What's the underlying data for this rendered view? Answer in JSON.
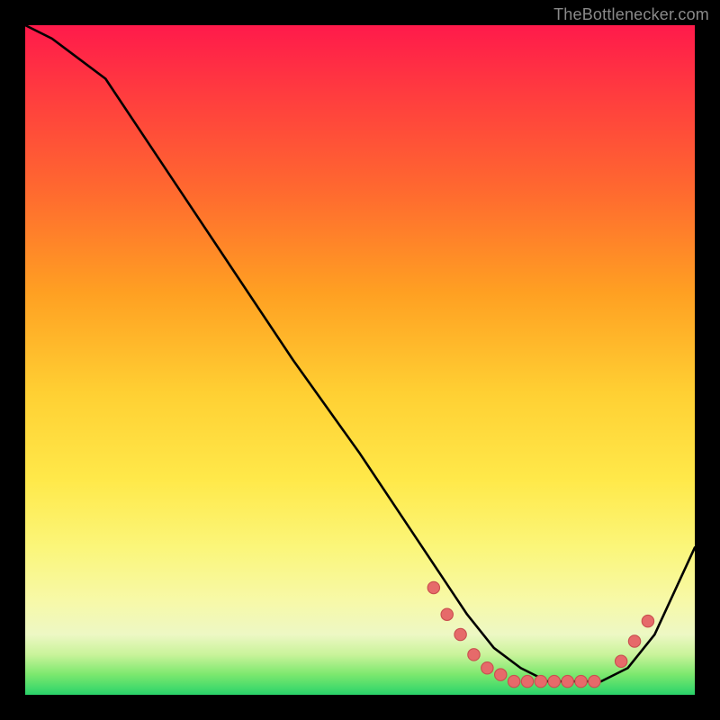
{
  "watermark": "TheBottlenecker.com",
  "colors": {
    "curve_stroke": "#000000",
    "dot_fill": "#e66a6a",
    "dot_stroke": "#c94f4f"
  },
  "chart_data": {
    "type": "line",
    "title": "",
    "xlabel": "",
    "ylabel": "",
    "xlim": [
      0,
      100
    ],
    "ylim": [
      0,
      100
    ],
    "grid": false,
    "note": "Axes are unlabeled; values are read off relative pixel positions (0–100).",
    "series": [
      {
        "name": "curve",
        "x": [
          0,
          4,
          8,
          12,
          20,
          30,
          40,
          50,
          58,
          62,
          66,
          70,
          74,
          78,
          82,
          86,
          90,
          94,
          100
        ],
        "y": [
          100,
          98,
          95,
          92,
          80,
          65,
          50,
          36,
          24,
          18,
          12,
          7,
          4,
          2,
          2,
          2,
          4,
          9,
          22
        ]
      }
    ],
    "dots": [
      {
        "x": 61,
        "y": 16
      },
      {
        "x": 63,
        "y": 12
      },
      {
        "x": 65,
        "y": 9
      },
      {
        "x": 67,
        "y": 6
      },
      {
        "x": 69,
        "y": 4
      },
      {
        "x": 71,
        "y": 3
      },
      {
        "x": 73,
        "y": 2
      },
      {
        "x": 75,
        "y": 2
      },
      {
        "x": 77,
        "y": 2
      },
      {
        "x": 79,
        "y": 2
      },
      {
        "x": 81,
        "y": 2
      },
      {
        "x": 83,
        "y": 2
      },
      {
        "x": 85,
        "y": 2
      },
      {
        "x": 89,
        "y": 5
      },
      {
        "x": 91,
        "y": 8
      },
      {
        "x": 93,
        "y": 11
      }
    ]
  }
}
